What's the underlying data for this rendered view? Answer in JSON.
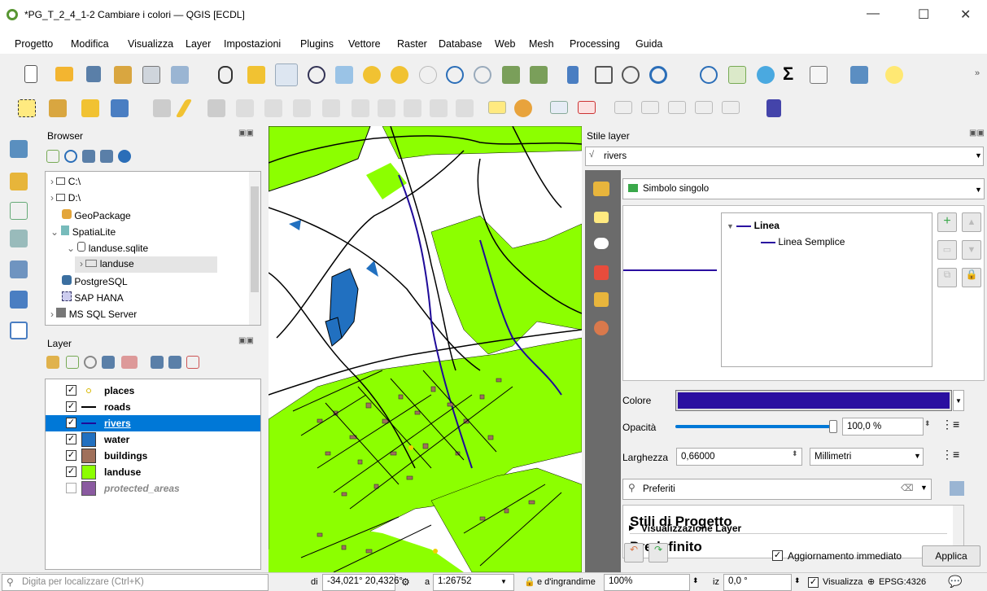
{
  "window": {
    "title": "*PG_T_2_4_1-2 Cambiare i colori — QGIS [ECDL]",
    "minimize": "—",
    "maximize": "☐",
    "close": "✕"
  },
  "menu": [
    "Progetto",
    "Modifica",
    "Visualizza",
    "Layer",
    "Impostazioni",
    "Plugins",
    "Vettore",
    "Raster",
    "Database",
    "Web",
    "Mesh",
    "Processing",
    "Guida"
  ],
  "browser": {
    "title": "Browser",
    "items": [
      "C:\\",
      "D:\\",
      "GeoPackage",
      "SpatiaLite",
      "landuse.sqlite",
      "landuse",
      "PostgreSQL",
      "SAP HANA",
      "MS SQL Server"
    ]
  },
  "layers": {
    "title": "Layer",
    "items": [
      {
        "name": "places",
        "checked": true,
        "color": "#d8b800"
      },
      {
        "name": "roads",
        "checked": true,
        "color": "#000000"
      },
      {
        "name": "rivers",
        "checked": true,
        "color": "#1f0a99"
      },
      {
        "name": "water",
        "checked": true,
        "color": "#2170c0"
      },
      {
        "name": "buildings",
        "checked": true,
        "color": "#a0705a"
      },
      {
        "name": "landuse",
        "checked": true,
        "color": "#8cff00"
      },
      {
        "name": "protected_areas",
        "checked": false,
        "color": "#8a5aa0"
      }
    ],
    "selected": "rivers"
  },
  "style_panel": {
    "title": "Stile layer",
    "layer_select": "rivers",
    "renderer": "Simbolo singolo",
    "tree_root": "Linea",
    "tree_child": "Linea Semplice",
    "color_label": "Colore",
    "color_value": "#2a0fa0",
    "opacity_label": "Opacità",
    "opacity_value": "100,0 %",
    "opacity_level": 1.0,
    "width_label": "Larghezza",
    "width_value": "0,66000",
    "unit_value": "Millimetri",
    "search_placeholder": "Preferiti",
    "styles": [
      "Stili di Progetto",
      "Predefinito"
    ],
    "visual_layer": "Visualizzazione Layer",
    "live_update": "Aggiornamento immediato",
    "apply": "Applica"
  },
  "status": {
    "locator_placeholder": "Digita per localizzare (Ctrl+K)",
    "coord_label": "di",
    "coord_value": "-34,021° 20,4326°",
    "scale_label": "a",
    "scale_value": "1:26752",
    "magnifier_label": "e d'ingrandime",
    "magnifier_value": "100%",
    "rotation_label": "iz",
    "rotation_value": "0,0 °",
    "render_label": "Visualizza",
    "crs": "EPSG:4326"
  }
}
